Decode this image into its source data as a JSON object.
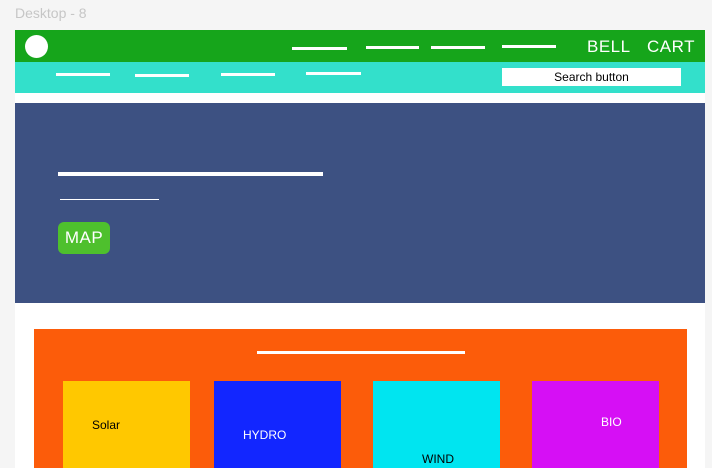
{
  "canvas": {
    "label": "Desktop - 8"
  },
  "topnav": {
    "bell_label": "BELL",
    "cart_label": "CART",
    "bg_color": "#16a51b"
  },
  "subnav": {
    "search_value": "Search button",
    "bg_color": "#33e0cb"
  },
  "hero": {
    "map_label": "MAP",
    "bg_color": "#3d5182",
    "button_color": "#4ec02d"
  },
  "energy": {
    "bg_color": "#fc5c0a",
    "cards": [
      {
        "label": "Solar",
        "color": "#ffc800",
        "text_color": "#000000"
      },
      {
        "label": "HYDRO",
        "color": "#1226ff",
        "text_color": "#ffffff"
      },
      {
        "label": "WIND",
        "color": "#00e5f0",
        "text_color": "#000000"
      },
      {
        "label": "BIO",
        "color": "#d60ff5",
        "text_color": "#ffffff"
      }
    ]
  }
}
